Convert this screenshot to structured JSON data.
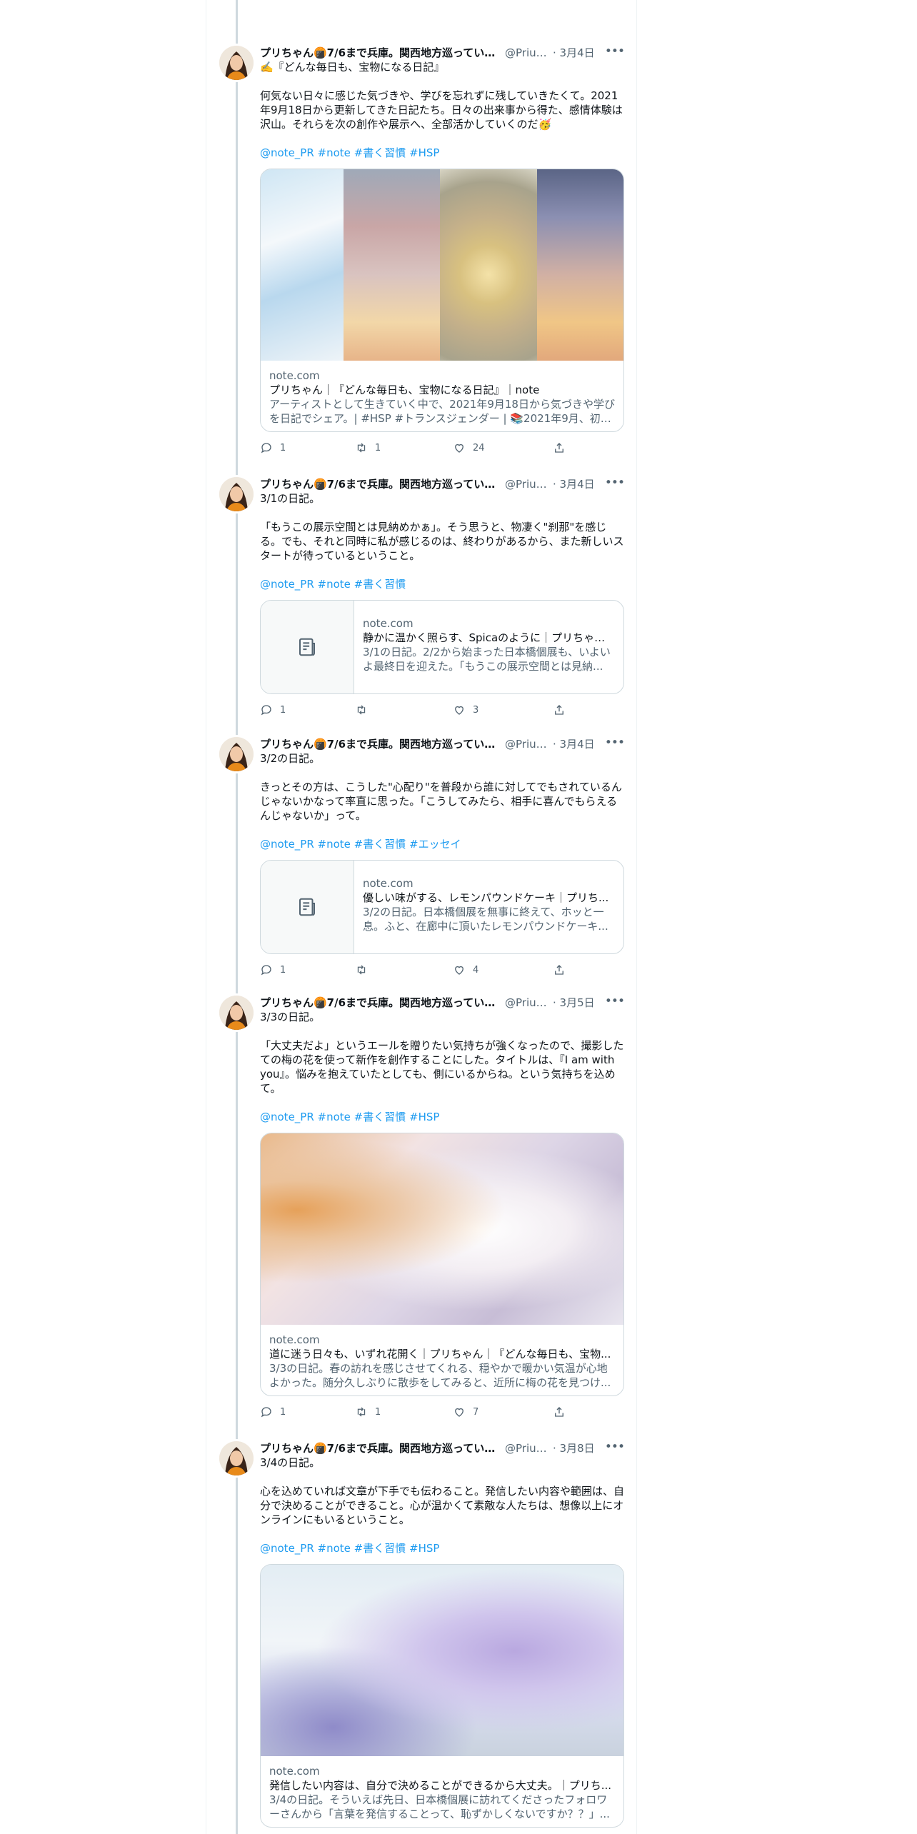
{
  "tweets": [
    {
      "name": "プリちゃん🍘7/6まで兵庫。関西地方巡ってい...",
      "handle": "@Prius...",
      "date": "· 3月4日",
      "text": "✍️『どんな毎日も、宝物になる日記』\n\n何気ない日々に感じた気づきや、学びを忘れずに残していきたくて。2021年9月18日から更新してきた日記たち。日々の出来事から得た、感情体験は沢山。それらを次の創作や展示へ、全部活かしていくのだ🥳",
      "hashtags": "@note_PR #note #書く習慣 #HSP",
      "card": {
        "domain": "note.com",
        "title": "プリちゃん｜『どんな毎日も、宝物になる日記』｜note",
        "desc": "アーティストとして生きていく中で、2021年9月18日から気づきや学びを日記でシェア。| #HSP #トランスジェンダー | 📚2021年9月、初の..."
      },
      "replies": "1",
      "retweets": "1",
      "likes": "24"
    },
    {
      "name": "プリちゃん🍘7/6まで兵庫。関西地方巡ってい...",
      "handle": "@Prius...",
      "date": "· 3月4日",
      "text": "3/1の日記。\n\n「もうこの展示空間とは見納めかぁ」。そう思うと、物凄く\"刹那\"を感じる。でも、それと同時に私が感じるのは、終わりがあるから、また新しいスタートが待っているということ。",
      "hashtags": "@note_PR #note #書く習慣",
      "card": {
        "domain": "note.com",
        "title": "静かに温かく照らす、Spicaのように｜プリちゃん...",
        "desc": "3/1の日記。2/2から始まった日本橋個展も、いよいよ最終日を迎えた。「もうこの展示空間とは見納..."
      },
      "replies": "1",
      "retweets": "",
      "likes": "3"
    },
    {
      "name": "プリちゃん🍘7/6まで兵庫。関西地方巡ってい...",
      "handle": "@Prius...",
      "date": "· 3月4日",
      "text": "3/2の日記。\n\nきっとその方は、こうした\"心配り\"を普段から誰に対してでもされているんじゃないかなって率直に思った。「こうしてみたら、相手に喜んでもらえるんじゃないか」って。",
      "hashtags": "@note_PR #note #書く習慣 #エッセイ",
      "card": {
        "domain": "note.com",
        "title": "優しい味がする、レモンパウンドケーキ｜プリち...",
        "desc": "3/2の日記。日本橋個展を無事に終えて、ホッと一息。ふと、在廊中に頂いたレモンパウンドケーキ..."
      },
      "replies": "1",
      "retweets": "",
      "likes": "4"
    },
    {
      "name": "プリちゃん🍘7/6まで兵庫。関西地方巡ってい...",
      "handle": "@Prius...",
      "date": "· 3月5日",
      "text": "3/3の日記。\n\n「大丈夫だよ」というエールを贈りたい気持ちが強くなったので、撮影したての梅の花を使って新作を創作することにした。タイトルは、『I am with you』。悩みを抱えていたとしても、側にいるからね。という気持ちを込めて。",
      "hashtags": "@note_PR #note #書く習慣 #HSP",
      "card": {
        "domain": "note.com",
        "title": "道に迷う日々も、いずれ花開く｜プリちゃん｜『どんな毎日も、宝物...",
        "desc": "3/3の日記。春の訪れを感じさせてくれる、穏やかで暖かい気温が心地よかった。随分久しぶりに散歩をしてみると、近所に梅の花を見つけ..."
      },
      "replies": "1",
      "retweets": "1",
      "likes": "7"
    },
    {
      "name": "プリちゃん🍘7/6まで兵庫。関西地方巡ってい...",
      "handle": "@Prius...",
      "date": "· 3月8日",
      "text": "3/4の日記。\n\n心を込めていれば文章が下手でも伝わること。発信したい内容や範囲は、自分で決めることができること。心が温かくて素敵な人たちは、想像以上にオンラインにもいるということ。",
      "hashtags": "@note_PR #note #書く習慣 #HSP",
      "card": {
        "domain": "note.com",
        "title": "発信したい内容は、自分で決めることができるから大丈夫。｜プリち...",
        "desc": "3/4の日記。そういえば先日、日本橋個展に訪れてくださったフォロワーさんから「言葉を発信することって、恥ずかしくないですか？？」..."
      },
      "replies": "",
      "retweets": "",
      "likes": ""
    }
  ],
  "icons": {
    "reply": "reply-icon",
    "retweet": "retweet-icon",
    "like": "like-icon",
    "share": "share-icon",
    "more": "more-icon",
    "article": "article-icon"
  },
  "colors": {
    "accent": "#1d9bf0",
    "secondary_text": "#536471",
    "border": "#cfd9de"
  }
}
